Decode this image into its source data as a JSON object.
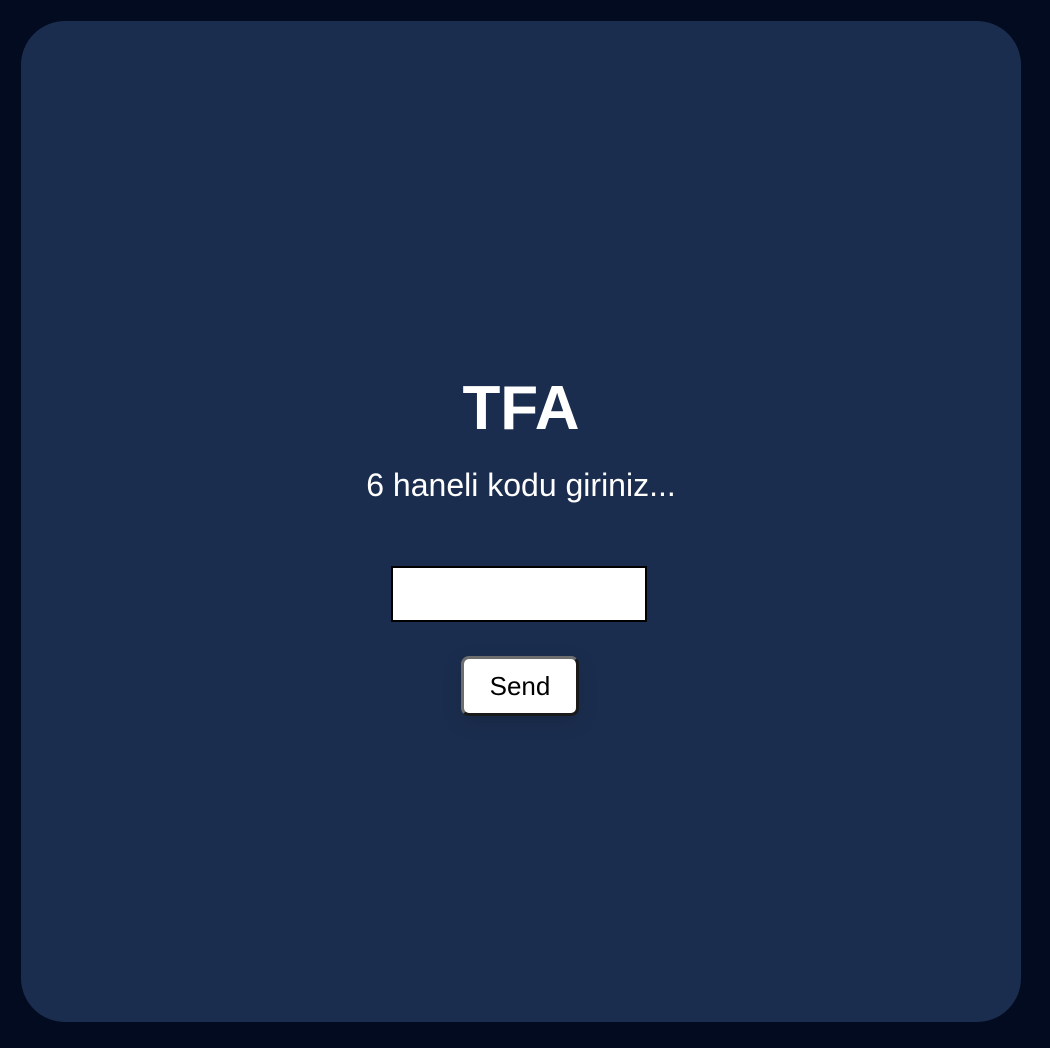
{
  "form": {
    "title": "TFA",
    "subtitle": "6 haneli kodu giriniz...",
    "code_input_value": "",
    "send_label": "Send"
  },
  "colors": {
    "page_background": "#020b1f",
    "card_background": "#1b2d4e",
    "text": "#ffffff",
    "input_background": "#ffffff",
    "button_background": "#ffffff"
  }
}
